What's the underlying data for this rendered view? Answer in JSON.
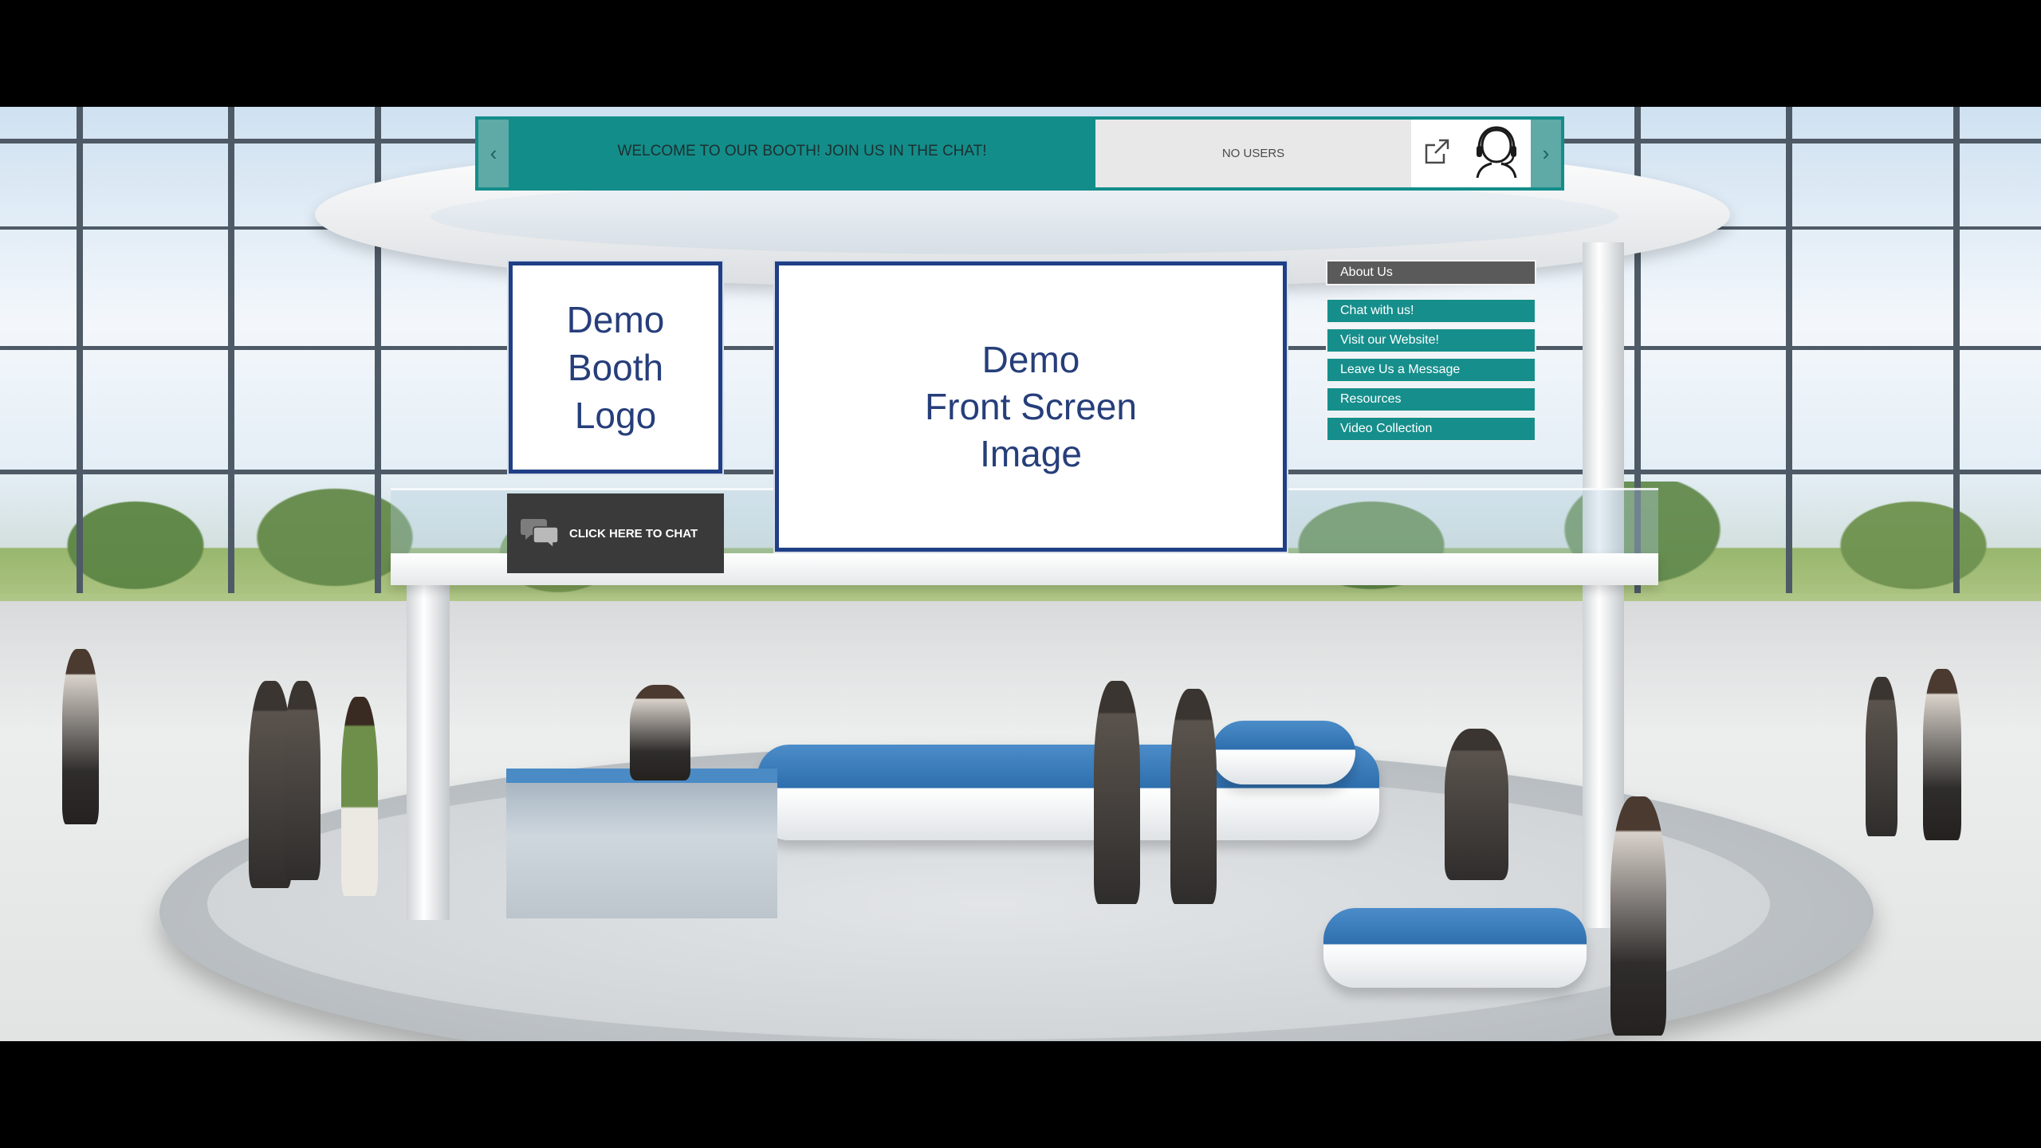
{
  "banner": {
    "prev_icon": "chevron-left-icon",
    "next_icon": "chevron-right-icon",
    "welcome_text": "WELCOME TO OUR BOOTH! JOIN US IN THE CHAT!",
    "users_text": "NO USERS",
    "popout_icon": "external-link-icon",
    "agent_icon": "headset-agent-icon",
    "accent_color": "#138d8a"
  },
  "booth": {
    "logo_lines": [
      "Demo",
      "Booth",
      "Logo"
    ],
    "screen_lines": [
      "Demo",
      "Front Screen",
      "Image"
    ],
    "chat_button_label": "CLICK HERE TO CHAT",
    "chat_icon": "chat-bubbles-icon"
  },
  "menu": {
    "items": [
      {
        "label": "About Us"
      },
      {
        "label": "Chat with us!"
      },
      {
        "label": "Visit our Website!"
      },
      {
        "label": "Leave Us a Message"
      },
      {
        "label": "Resources"
      },
      {
        "label": "Video Collection"
      }
    ]
  }
}
